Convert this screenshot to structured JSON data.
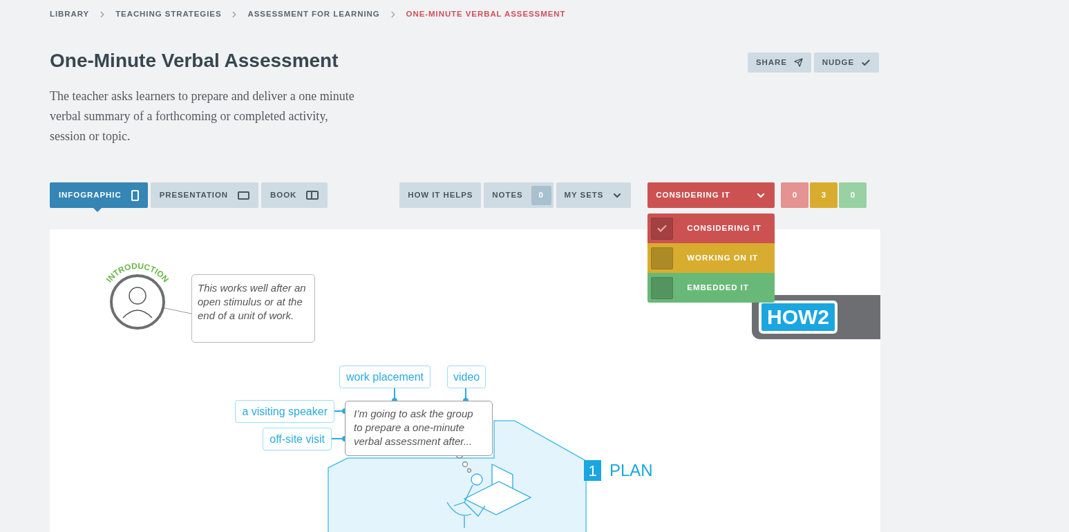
{
  "breadcrumb": [
    {
      "label": "LIBRARY",
      "current": false
    },
    {
      "label": "TEACHING STRATEGIES",
      "current": false
    },
    {
      "label": "ASSESSMENT FOR LEARNING",
      "current": false
    },
    {
      "label": "ONE-MINUTE VERBAL ASSESSMENT",
      "current": true
    }
  ],
  "title": "One-Minute Verbal Assessment",
  "description": "The teacher asks learners to prepare and deliver a one minute verbal summary of a forthcoming or completed activity, session or topic.",
  "actions": [
    {
      "label": "SHARE",
      "kind": "share"
    },
    {
      "label": "NUDGE",
      "kind": "nudge"
    }
  ],
  "view_tabs": [
    {
      "label": "INFOGRAPHIC",
      "selected": true,
      "kind": "portrait"
    },
    {
      "label": "PRESENTATION",
      "selected": false,
      "kind": "landscape"
    },
    {
      "label": "BOOK",
      "selected": false,
      "kind": "book"
    }
  ],
  "tools": [
    {
      "label": "HOW IT HELPS",
      "kind": "plain"
    },
    {
      "label": "NOTES",
      "kind": "count",
      "count": "0"
    },
    {
      "label": "MY SETS",
      "kind": "menu"
    }
  ],
  "status": {
    "label": "CONSIDERING IT",
    "color": "#cc5252",
    "expanded": true,
    "options": [
      {
        "label": "CONSIDERING IT",
        "color": "#cc5252",
        "selected": true
      },
      {
        "label": "WORKING ON IT",
        "color": "#d8ad2f",
        "selected": false
      },
      {
        "label": "EMBEDDED IT",
        "color": "#68b978",
        "selected": false
      }
    ]
  },
  "counts": [
    {
      "value": "0",
      "color": "#e49292"
    },
    {
      "value": "3",
      "color": "#d8ad2f"
    },
    {
      "value": "0",
      "color": "#98d1a3"
    }
  ],
  "infographic": {
    "intro": {
      "badge": "INTRODUCTION",
      "quote": "This works well after an open stimulus or at the end of a unit of work."
    },
    "logo": "HOW2",
    "thought": "I’m going to ask the group to prepare a one-minute verbal assessment after...",
    "tags": [
      "work placement",
      "video",
      "a visiting speaker",
      "off-site visit"
    ],
    "step": {
      "number": "1",
      "label": "PLAN"
    }
  }
}
